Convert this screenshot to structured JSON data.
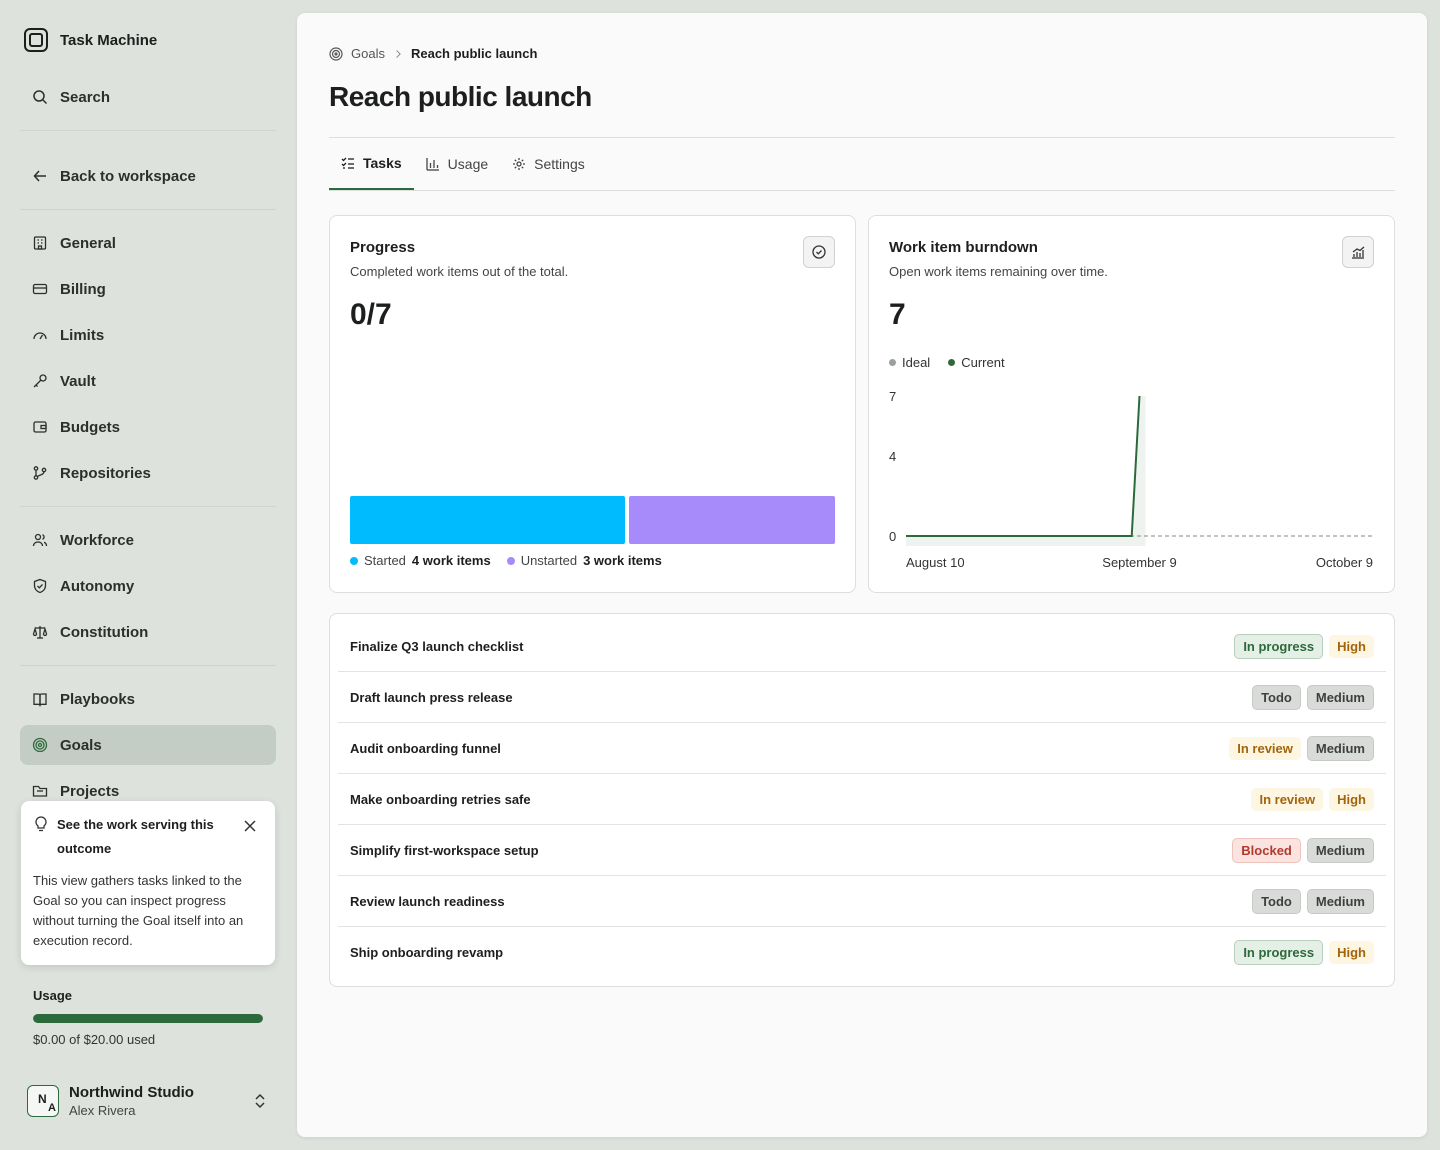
{
  "app": {
    "name": "Task Machine",
    "logo_icon": "square-logo-icon"
  },
  "sidebar": {
    "search_label": "Search",
    "back_label": "Back to workspace",
    "groups": [
      [
        {
          "label": "General",
          "icon": "building-icon"
        },
        {
          "label": "Billing",
          "icon": "credit-card-icon"
        },
        {
          "label": "Limits",
          "icon": "gauge-icon"
        },
        {
          "label": "Vault",
          "icon": "key-icon"
        },
        {
          "label": "Budgets",
          "icon": "wallet-icon"
        },
        {
          "label": "Repositories",
          "icon": "git-branch-icon"
        }
      ],
      [
        {
          "label": "Workforce",
          "icon": "users-icon"
        },
        {
          "label": "Autonomy",
          "icon": "shield-icon"
        },
        {
          "label": "Constitution",
          "icon": "scale-icon"
        }
      ],
      [
        {
          "label": "Playbooks",
          "icon": "book-icon"
        },
        {
          "label": "Goals",
          "icon": "target-icon",
          "active": true
        },
        {
          "label": "Projects",
          "icon": "folder-icon"
        }
      ]
    ],
    "tip": {
      "title": "See the work serving this outcome",
      "body": "This view gathers tasks linked to the Goal so you can inspect progress without turning the Goal itself into an execution record."
    },
    "usage": {
      "label": "Usage",
      "text": "$0.00 of $20.00 used",
      "fill_fraction": 1.0,
      "color": "#2d6a3b"
    },
    "account": {
      "initial_1": "N",
      "initial_2": "A",
      "name": "Northwind Studio",
      "user": "Alex Rivera"
    }
  },
  "breadcrumb": {
    "root": "Goals",
    "current": "Reach public launch"
  },
  "page_title": "Reach public launch",
  "tabs": [
    {
      "label": "Tasks",
      "icon": "checklist-icon",
      "active": true
    },
    {
      "label": "Usage",
      "icon": "bar-chart-icon"
    },
    {
      "label": "Settings",
      "icon": "gear-icon"
    }
  ],
  "progress": {
    "title": "Progress",
    "subtitle": "Completed work items out of the total.",
    "value": "0/7",
    "segments": [
      {
        "name": "Started",
        "count": 4,
        "count_label": "4 work items",
        "color": "#00bcff"
      },
      {
        "name": "Unstarted",
        "count": 3,
        "count_label": "3 work items",
        "color": "#a78bfa"
      }
    ]
  },
  "burndown": {
    "title": "Work item burndown",
    "subtitle": "Open work items remaining over time.",
    "value": "7",
    "legend": {
      "ideal": "Ideal",
      "current": "Current"
    }
  },
  "chart_data": {
    "type": "line",
    "x_ticks": [
      "August 10",
      "September 9",
      "October 9"
    ],
    "y_ticks": [
      0,
      4,
      7
    ],
    "ylim": [
      0,
      7
    ],
    "series": [
      {
        "name": "Ideal",
        "color": "#9aa09b",
        "points": [
          [
            0,
            0
          ],
          [
            30,
            0
          ],
          [
            60,
            0
          ]
        ]
      },
      {
        "name": "Current",
        "color": "#2d6a3b",
        "points": [
          [
            0,
            0
          ],
          [
            29,
            0
          ],
          [
            30,
            7
          ]
        ]
      }
    ]
  },
  "tasks": [
    {
      "title": "Finalize Q3 launch checklist",
      "status": "In progress",
      "status_kind": "progress",
      "priority": "High",
      "priority_kind": "high"
    },
    {
      "title": "Draft launch press release",
      "status": "Todo",
      "status_kind": "todo",
      "priority": "Medium",
      "priority_kind": "medium"
    },
    {
      "title": "Audit onboarding funnel",
      "status": "In review",
      "status_kind": "review",
      "priority": "Medium",
      "priority_kind": "medium"
    },
    {
      "title": "Make onboarding retries safe",
      "status": "In review",
      "status_kind": "review",
      "priority": "High",
      "priority_kind": "high"
    },
    {
      "title": "Simplify first-workspace setup",
      "status": "Blocked",
      "status_kind": "blocked",
      "priority": "Medium",
      "priority_kind": "medium"
    },
    {
      "title": "Review launch readiness",
      "status": "Todo",
      "status_kind": "todo",
      "priority": "Medium",
      "priority_kind": "medium"
    },
    {
      "title": "Ship onboarding revamp",
      "status": "In progress",
      "status_kind": "progress",
      "priority": "High",
      "priority_kind": "high"
    }
  ]
}
